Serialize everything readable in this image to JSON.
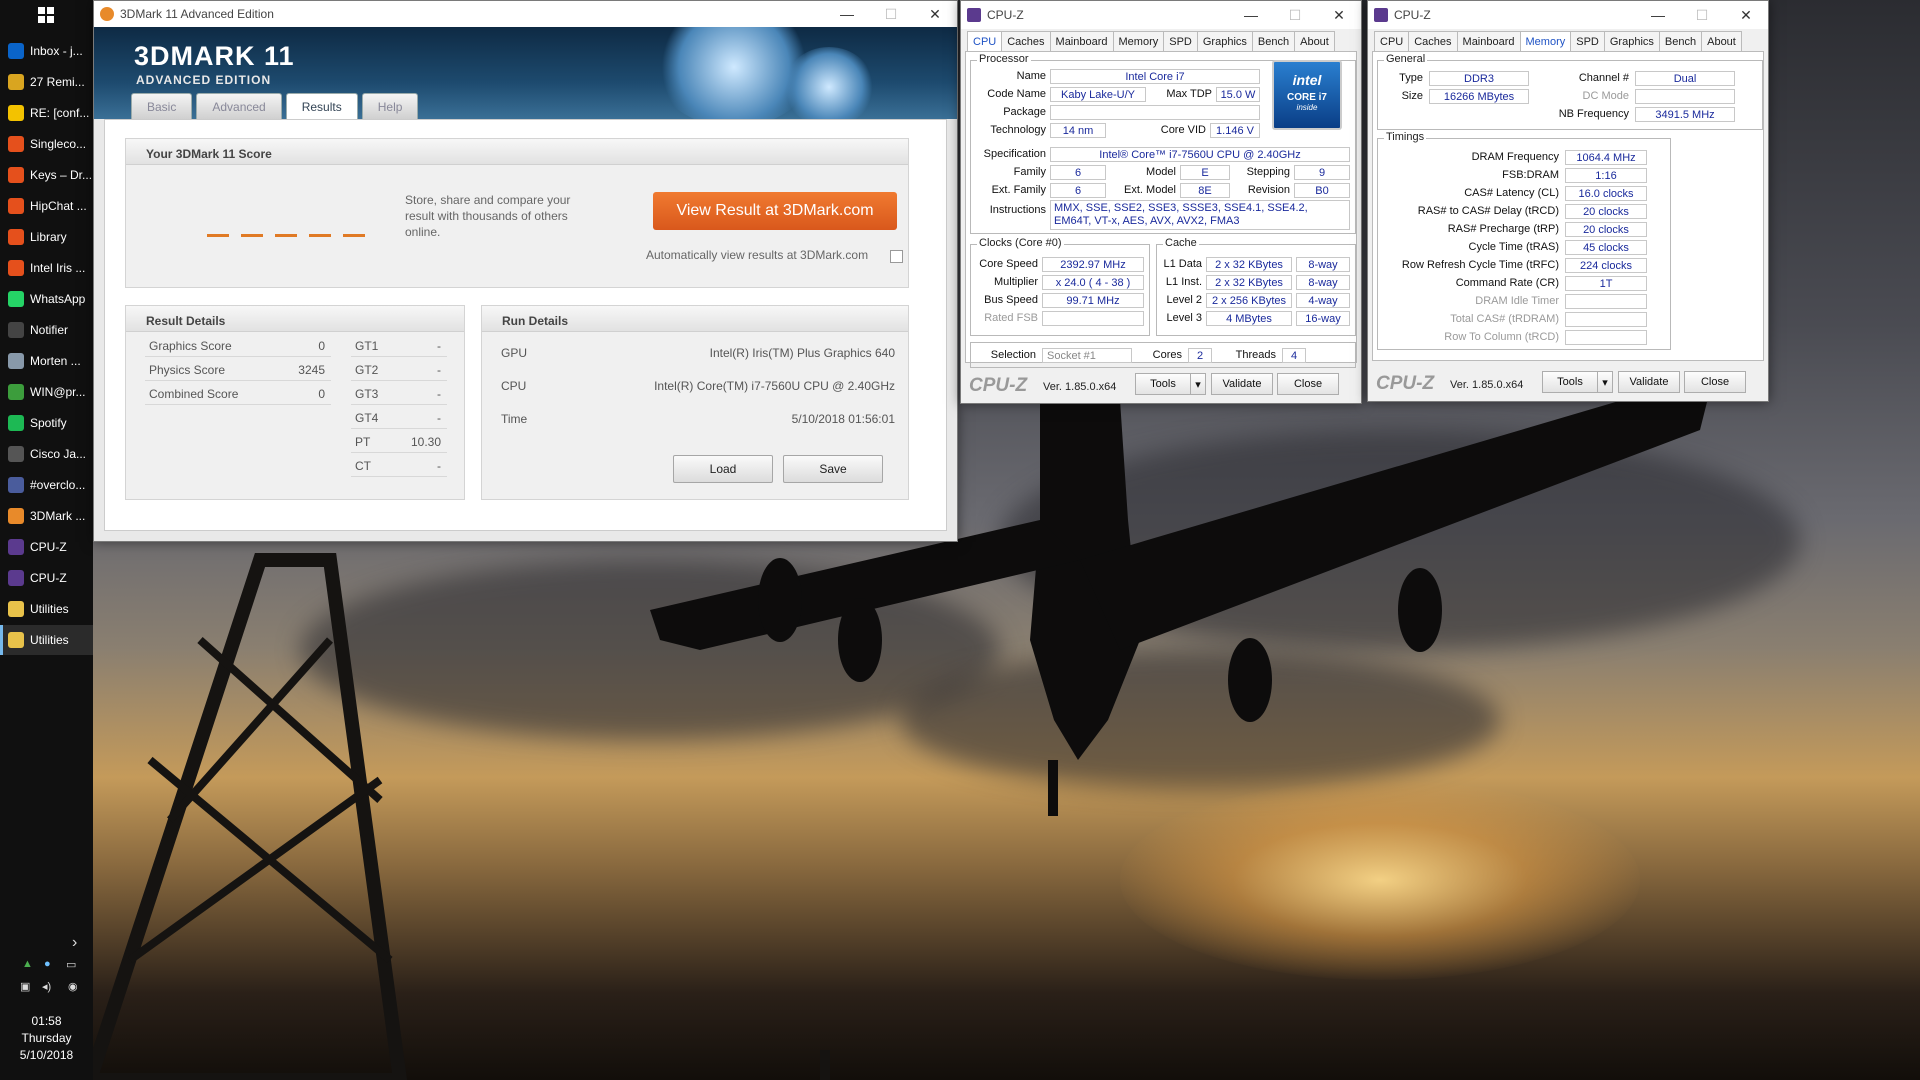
{
  "taskbar": {
    "items": [
      {
        "label": "Inbox - j...",
        "icon": "outlook-icon",
        "color": "#0a64c9"
      },
      {
        "label": "27 Remi...",
        "icon": "reminder-bell-icon",
        "color": "#d9a520"
      },
      {
        "label": "RE: [conf...",
        "icon": "mail-icon",
        "color": "#f3c200"
      },
      {
        "label": "Singleco...",
        "icon": "firefox-icon",
        "color": "#e5501c"
      },
      {
        "label": "Keys – Dr...",
        "icon": "firefox-icon",
        "color": "#e5501c"
      },
      {
        "label": "HipChat ...",
        "icon": "firefox-icon",
        "color": "#e5501c"
      },
      {
        "label": "Library",
        "icon": "firefox-icon",
        "color": "#e5501c"
      },
      {
        "label": "Intel Iris ...",
        "icon": "firefox-icon",
        "color": "#e5501c"
      },
      {
        "label": "WhatsApp",
        "icon": "whatsapp-icon",
        "color": "#25d366"
      },
      {
        "label": "Notifier",
        "icon": "notifier-bell-icon",
        "color": "#444"
      },
      {
        "label": "Morten ...",
        "icon": "chat-bubble-icon",
        "color": "#8899aa"
      },
      {
        "label": "WIN@pr...",
        "icon": "putty-icon",
        "color": "#3c9d3c"
      },
      {
        "label": "Spotify",
        "icon": "spotify-icon",
        "color": "#1db954"
      },
      {
        "label": "Cisco Ja...",
        "icon": "cisco-jabber-icon",
        "color": "#555"
      },
      {
        "label": "#overclo...",
        "icon": "irc-icon",
        "color": "#4a5c9c"
      },
      {
        "label": "3DMark ...",
        "icon": "3dmark-icon",
        "color": "#e88a2a"
      },
      {
        "label": "CPU-Z",
        "icon": "cpuz-icon",
        "color": "#5b3a8e"
      },
      {
        "label": "CPU-Z",
        "icon": "cpuz-icon",
        "color": "#5b3a8e"
      },
      {
        "label": "Utilities",
        "icon": "folder-icon",
        "color": "#e8c24a"
      },
      {
        "label": "Utilities",
        "icon": "folder-icon",
        "color": "#e8c24a"
      }
    ],
    "clock": {
      "time": "01:58",
      "day": "Thursday",
      "date": "5/10/2018"
    }
  },
  "mark": {
    "title": "3DMark 11 Advanced Edition",
    "logo_main": "3DMARK 11",
    "logo_sub": "ADVANCED EDITION",
    "tabs": [
      "Basic",
      "Advanced",
      "Results",
      "Help"
    ],
    "active_tab": "Results",
    "score_header": "Your 3DMark 11 Score",
    "store_text": "Store, share and compare your result with thousands of others online.",
    "view_button": "View Result at 3DMark.com",
    "auto_view": "Automatically view results at 3DMark.com",
    "result_header": "Result Details",
    "results": [
      {
        "label": "Graphics Score",
        "value": "0"
      },
      {
        "label": "Physics Score",
        "value": "3245"
      },
      {
        "label": "Combined Score",
        "value": "0"
      }
    ],
    "tests": [
      {
        "label": "GT1",
        "value": "-"
      },
      {
        "label": "GT2",
        "value": "-"
      },
      {
        "label": "GT3",
        "value": "-"
      },
      {
        "label": "GT4",
        "value": "-"
      },
      {
        "label": "PT",
        "value": "10.30"
      },
      {
        "label": "CT",
        "value": "-"
      }
    ],
    "run_header": "Run Details",
    "run": [
      {
        "label": "GPU",
        "value": "Intel(R) Iris(TM) Plus Graphics 640"
      },
      {
        "label": "CPU",
        "value": "Intel(R) Core(TM) i7-7560U CPU @ 2.40GHz"
      },
      {
        "label": "Time",
        "value": "5/10/2018 01:56:01"
      }
    ],
    "load": "Load",
    "save": "Save",
    "accent": "#e07a25"
  },
  "cpuz1": {
    "title": "CPU-Z",
    "tabs": [
      "CPU",
      "Caches",
      "Mainboard",
      "Memory",
      "SPD",
      "Graphics",
      "Bench",
      "About"
    ],
    "active_tab": "CPU",
    "processor": "Processor",
    "name_l": "Name",
    "name": "Intel Core i7",
    "codename_l": "Code Name",
    "codename": "Kaby Lake-U/Y",
    "tdp_l": "Max TDP",
    "tdp": "15.0 W",
    "package_l": "Package",
    "package": "",
    "tech_l": "Technology",
    "tech": "14 nm",
    "vid_l": "Core VID",
    "vid": "1.146 V",
    "spec_l": "Specification",
    "spec": "Intel® Core™ i7-7560U CPU @ 2.40GHz",
    "family_l": "Family",
    "family": "6",
    "model_l": "Model",
    "model": "E",
    "stepping_l": "Stepping",
    "stepping": "9",
    "extfam_l": "Ext. Family",
    "extfam": "6",
    "extmod_l": "Ext. Model",
    "extmod": "8E",
    "rev_l": "Revision",
    "rev": "B0",
    "instr_l": "Instructions",
    "instr": "MMX, SSE, SSE2, SSE3, SSSE3, SSE4.1, SSE4.2, EM64T, VT-x, AES, AVX, AVX2, FMA3",
    "clocks": "Clocks (Core #0)",
    "speed_l": "Core Speed",
    "speed": "2392.97 MHz",
    "mult_l": "Multiplier",
    "mult": "x 24.0 ( 4 - 38 )",
    "bus_l": "Bus Speed",
    "bus": "99.71 MHz",
    "fsb_l": "Rated FSB",
    "fsb": "",
    "cache": "Cache",
    "l1d_l": "L1 Data",
    "l1d": "2 x 32 KBytes",
    "l1d_w": "8-way",
    "l1i_l": "L1 Inst.",
    "l1i": "2 x 32 KBytes",
    "l1i_w": "8-way",
    "l2_l": "Level 2",
    "l2": "2 x 256 KBytes",
    "l2_w": "4-way",
    "l3_l": "Level 3",
    "l3": "4 MBytes",
    "l3_w": "16-way",
    "sel_l": "Selection",
    "sel": "Socket #1",
    "cores_l": "Cores",
    "cores": "2",
    "threads_l": "Threads",
    "threads": "4",
    "intel_brand": "intel",
    "intel_line": "CORE i7",
    "intel_inside": "inside",
    "version": "Ver. 1.85.0.x64",
    "tools": "Tools",
    "validate": "Validate",
    "close": "Close"
  },
  "cpuz2": {
    "title": "CPU-Z",
    "tabs": [
      "CPU",
      "Caches",
      "Mainboard",
      "Memory",
      "SPD",
      "Graphics",
      "Bench",
      "About"
    ],
    "active_tab": "Memory",
    "general": "General",
    "type_l": "Type",
    "type": "DDR3",
    "size_l": "Size",
    "size": "16266 MBytes",
    "channel_l": "Channel #",
    "channel": "Dual",
    "dcmode_l": "DC Mode",
    "dcmode": "",
    "nbfreq_l": "NB Frequency",
    "nbfreq": "3491.5 MHz",
    "timings": "Timings",
    "rows": [
      {
        "label": "DRAM Frequency",
        "value": "1064.4 MHz",
        "dim": false
      },
      {
        "label": "FSB:DRAM",
        "value": "1:16",
        "dim": false
      },
      {
        "label": "CAS# Latency (CL)",
        "value": "16.0 clocks",
        "dim": false
      },
      {
        "label": "RAS# to CAS# Delay (tRCD)",
        "value": "20 clocks",
        "dim": false
      },
      {
        "label": "RAS# Precharge (tRP)",
        "value": "20 clocks",
        "dim": false
      },
      {
        "label": "Cycle Time (tRAS)",
        "value": "45 clocks",
        "dim": false
      },
      {
        "label": "Row Refresh Cycle Time (tRFC)",
        "value": "224 clocks",
        "dim": false
      },
      {
        "label": "Command Rate (CR)",
        "value": "1T",
        "dim": false
      },
      {
        "label": "DRAM Idle Timer",
        "value": "",
        "dim": true
      },
      {
        "label": "Total CAS# (tRDRAM)",
        "value": "",
        "dim": true
      },
      {
        "label": "Row To Column (tRCD)",
        "value": "",
        "dim": true
      }
    ],
    "version": "Ver. 1.85.0.x64",
    "tools": "Tools",
    "validate": "Validate",
    "close": "Close"
  }
}
